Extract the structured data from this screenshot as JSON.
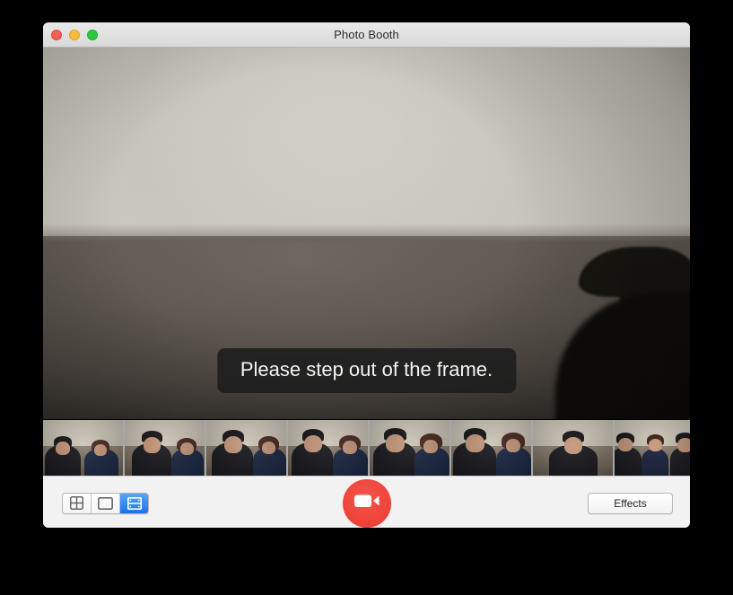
{
  "window": {
    "title": "Photo Booth",
    "traffic_lights": [
      {
        "name": "close",
        "color": "#fa5e57"
      },
      {
        "name": "minimize",
        "color": "#f6bd3b"
      },
      {
        "name": "maximize",
        "color": "#2bc840"
      }
    ]
  },
  "preview": {
    "banner_message": "Please step out of the frame.",
    "description": "Live webcam preview showing an empty room: light beige upper wall, darker lower wall, and a dark silhouette at the right edge"
  },
  "thumbnails": {
    "count": 8,
    "items": [
      {
        "label": "thumbnail-1",
        "subjects": 2
      },
      {
        "label": "thumbnail-2",
        "subjects": 2
      },
      {
        "label": "thumbnail-3",
        "subjects": 2
      },
      {
        "label": "thumbnail-4",
        "subjects": 2
      },
      {
        "label": "thumbnail-5",
        "subjects": 2
      },
      {
        "label": "thumbnail-6",
        "subjects": 2
      },
      {
        "label": "thumbnail-7",
        "subjects": 1
      },
      {
        "label": "thumbnail-8",
        "subjects": 3
      }
    ]
  },
  "toolbar": {
    "mode_selector": {
      "options": [
        {
          "id": "four-up",
          "icon": "grid-four-icon",
          "selected": false
        },
        {
          "id": "single-photo",
          "icon": "single-frame-icon",
          "selected": false
        },
        {
          "id": "movie",
          "icon": "film-strip-icon",
          "selected": true
        }
      ],
      "selected_id": "movie",
      "selected_color": "#1b73e8"
    },
    "record_button": {
      "icon": "video-camera-icon",
      "color": "#ee4238"
    },
    "effects_label": "Effects"
  }
}
